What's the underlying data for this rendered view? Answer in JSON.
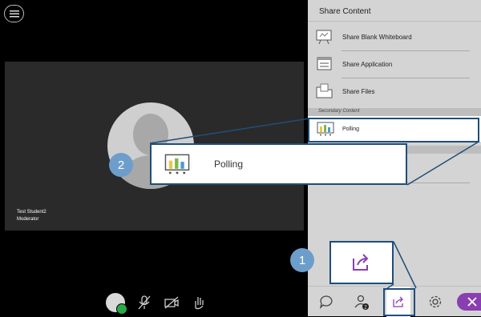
{
  "participant": {
    "name": "Test Student2",
    "role": "Moderator"
  },
  "panel": {
    "title": "Share Content",
    "items": [
      {
        "label": "Share Blank Whiteboard",
        "icon": "whiteboard-icon"
      },
      {
        "label": "Share Application",
        "icon": "application-window-icon"
      },
      {
        "label": "Share Files",
        "icon": "folder-icon"
      }
    ],
    "secondary_label": "Secondary Content",
    "polling_label": "Polling"
  },
  "callout": {
    "polling_label": "Polling",
    "step1": "1",
    "step2": "2"
  },
  "tabs": {
    "attendee_count": "2"
  },
  "colors": {
    "accent_purple": "#8a3fb0",
    "callout_blue": "#6d9ecb",
    "outline_navy": "#1f4e79",
    "panel_bg": "#d4d4d4"
  }
}
